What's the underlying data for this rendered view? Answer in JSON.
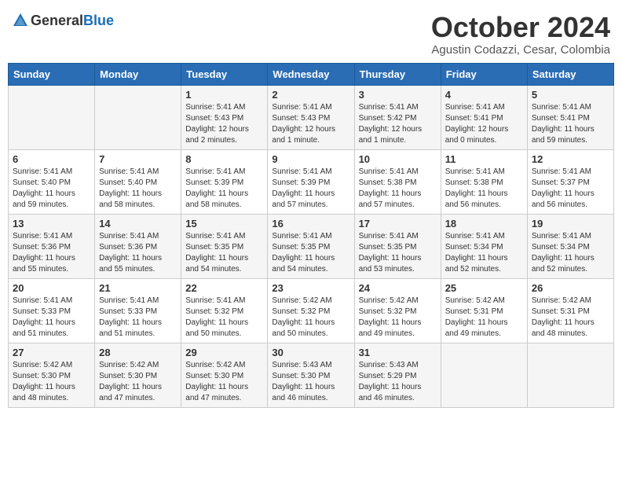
{
  "header": {
    "logo_general": "General",
    "logo_blue": "Blue",
    "month_title": "October 2024",
    "location": "Agustin Codazzi, Cesar, Colombia"
  },
  "weekdays": [
    "Sunday",
    "Monday",
    "Tuesday",
    "Wednesday",
    "Thursday",
    "Friday",
    "Saturday"
  ],
  "weeks": [
    [
      {
        "day": "",
        "details": ""
      },
      {
        "day": "",
        "details": ""
      },
      {
        "day": "1",
        "details": "Sunrise: 5:41 AM\nSunset: 5:43 PM\nDaylight: 12 hours\nand 2 minutes."
      },
      {
        "day": "2",
        "details": "Sunrise: 5:41 AM\nSunset: 5:43 PM\nDaylight: 12 hours\nand 1 minute."
      },
      {
        "day": "3",
        "details": "Sunrise: 5:41 AM\nSunset: 5:42 PM\nDaylight: 12 hours\nand 1 minute."
      },
      {
        "day": "4",
        "details": "Sunrise: 5:41 AM\nSunset: 5:41 PM\nDaylight: 12 hours\nand 0 minutes."
      },
      {
        "day": "5",
        "details": "Sunrise: 5:41 AM\nSunset: 5:41 PM\nDaylight: 11 hours\nand 59 minutes."
      }
    ],
    [
      {
        "day": "6",
        "details": "Sunrise: 5:41 AM\nSunset: 5:40 PM\nDaylight: 11 hours\nand 59 minutes."
      },
      {
        "day": "7",
        "details": "Sunrise: 5:41 AM\nSunset: 5:40 PM\nDaylight: 11 hours\nand 58 minutes."
      },
      {
        "day": "8",
        "details": "Sunrise: 5:41 AM\nSunset: 5:39 PM\nDaylight: 11 hours\nand 58 minutes."
      },
      {
        "day": "9",
        "details": "Sunrise: 5:41 AM\nSunset: 5:39 PM\nDaylight: 11 hours\nand 57 minutes."
      },
      {
        "day": "10",
        "details": "Sunrise: 5:41 AM\nSunset: 5:38 PM\nDaylight: 11 hours\nand 57 minutes."
      },
      {
        "day": "11",
        "details": "Sunrise: 5:41 AM\nSunset: 5:38 PM\nDaylight: 11 hours\nand 56 minutes."
      },
      {
        "day": "12",
        "details": "Sunrise: 5:41 AM\nSunset: 5:37 PM\nDaylight: 11 hours\nand 56 minutes."
      }
    ],
    [
      {
        "day": "13",
        "details": "Sunrise: 5:41 AM\nSunset: 5:36 PM\nDaylight: 11 hours\nand 55 minutes."
      },
      {
        "day": "14",
        "details": "Sunrise: 5:41 AM\nSunset: 5:36 PM\nDaylight: 11 hours\nand 55 minutes."
      },
      {
        "day": "15",
        "details": "Sunrise: 5:41 AM\nSunset: 5:35 PM\nDaylight: 11 hours\nand 54 minutes."
      },
      {
        "day": "16",
        "details": "Sunrise: 5:41 AM\nSunset: 5:35 PM\nDaylight: 11 hours\nand 54 minutes."
      },
      {
        "day": "17",
        "details": "Sunrise: 5:41 AM\nSunset: 5:35 PM\nDaylight: 11 hours\nand 53 minutes."
      },
      {
        "day": "18",
        "details": "Sunrise: 5:41 AM\nSunset: 5:34 PM\nDaylight: 11 hours\nand 52 minutes."
      },
      {
        "day": "19",
        "details": "Sunrise: 5:41 AM\nSunset: 5:34 PM\nDaylight: 11 hours\nand 52 minutes."
      }
    ],
    [
      {
        "day": "20",
        "details": "Sunrise: 5:41 AM\nSunset: 5:33 PM\nDaylight: 11 hours\nand 51 minutes."
      },
      {
        "day": "21",
        "details": "Sunrise: 5:41 AM\nSunset: 5:33 PM\nDaylight: 11 hours\nand 51 minutes."
      },
      {
        "day": "22",
        "details": "Sunrise: 5:41 AM\nSunset: 5:32 PM\nDaylight: 11 hours\nand 50 minutes."
      },
      {
        "day": "23",
        "details": "Sunrise: 5:42 AM\nSunset: 5:32 PM\nDaylight: 11 hours\nand 50 minutes."
      },
      {
        "day": "24",
        "details": "Sunrise: 5:42 AM\nSunset: 5:32 PM\nDaylight: 11 hours\nand 49 minutes."
      },
      {
        "day": "25",
        "details": "Sunrise: 5:42 AM\nSunset: 5:31 PM\nDaylight: 11 hours\nand 49 minutes."
      },
      {
        "day": "26",
        "details": "Sunrise: 5:42 AM\nSunset: 5:31 PM\nDaylight: 11 hours\nand 48 minutes."
      }
    ],
    [
      {
        "day": "27",
        "details": "Sunrise: 5:42 AM\nSunset: 5:30 PM\nDaylight: 11 hours\nand 48 minutes."
      },
      {
        "day": "28",
        "details": "Sunrise: 5:42 AM\nSunset: 5:30 PM\nDaylight: 11 hours\nand 47 minutes."
      },
      {
        "day": "29",
        "details": "Sunrise: 5:42 AM\nSunset: 5:30 PM\nDaylight: 11 hours\nand 47 minutes."
      },
      {
        "day": "30",
        "details": "Sunrise: 5:43 AM\nSunset: 5:30 PM\nDaylight: 11 hours\nand 46 minutes."
      },
      {
        "day": "31",
        "details": "Sunrise: 5:43 AM\nSunset: 5:29 PM\nDaylight: 11 hours\nand 46 minutes."
      },
      {
        "day": "",
        "details": ""
      },
      {
        "day": "",
        "details": ""
      }
    ]
  ]
}
